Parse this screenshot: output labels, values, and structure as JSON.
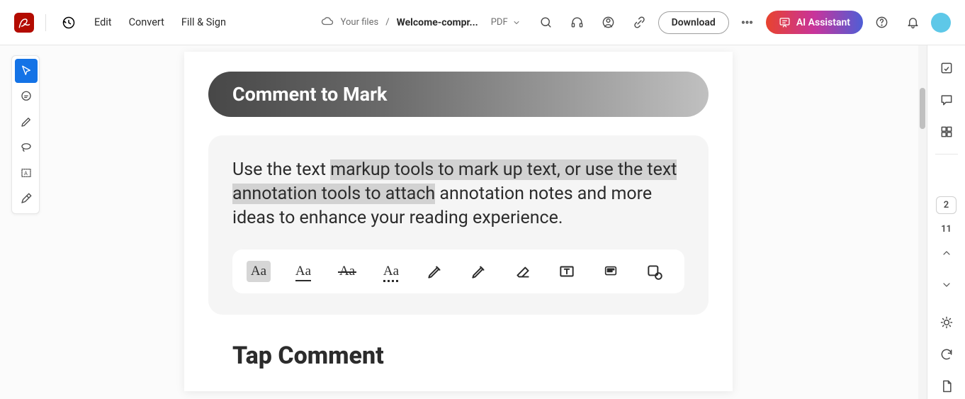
{
  "header": {
    "menu": {
      "edit": "Edit",
      "convert": "Convert",
      "fill_sign": "Fill & Sign"
    },
    "breadcrumb": {
      "root": "Your files",
      "sep": "/",
      "current": "Welcome-compr..."
    },
    "filetype": "PDF",
    "download": "Download",
    "ai_assistant": "AI Assistant"
  },
  "page": {
    "pill_heading": "Comment to Mark",
    "body_pre": "Use the text ",
    "body_highlight": "markup tools to mark up text, or use the text annotation tools to attach",
    "body_post": " annotation notes and more ideas to enhance your reading experience.",
    "h2": "Tap Comment",
    "tool_glyph": "Aa"
  },
  "right": {
    "current_page": "2",
    "total_pages": "11"
  }
}
